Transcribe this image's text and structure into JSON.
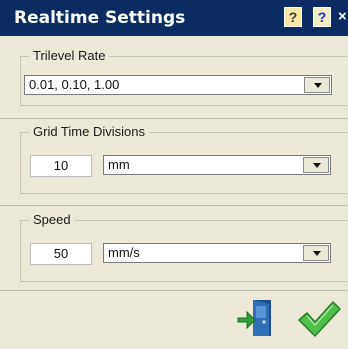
{
  "window": {
    "title": "Realtime Settings",
    "hint_label": "?",
    "help_label": "?",
    "close_label": "×"
  },
  "trilevel": {
    "legend": "Trilevel Rate",
    "value": "0.01, 0.10, 1.00"
  },
  "grid": {
    "legend": "Grid Time Divisions",
    "value": "10",
    "unit": "mm"
  },
  "speed": {
    "legend": "Speed",
    "value": "50",
    "unit": "mm/s"
  },
  "actions": {
    "exit_icon": "exit-door-icon",
    "ok_icon": "checkmark-icon"
  },
  "colors": {
    "titlebar": "#0b2c63",
    "panel": "#ece9d8",
    "check": "#3aa83a",
    "door": "#2f6fb7",
    "exit_arrow": "#2fa33a"
  }
}
